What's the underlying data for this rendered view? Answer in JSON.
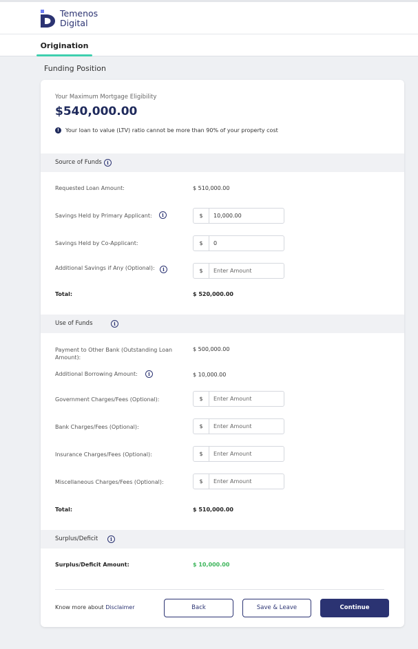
{
  "brand": {
    "line1": "Temenos",
    "line2": "Digital",
    "color": "#2b3372"
  },
  "tabs": [
    {
      "label": "Origination",
      "active": true
    }
  ],
  "page_title": "Funding Position",
  "eligibility": {
    "label": "Your Maximum Mortgage Eligibility",
    "amount": "$540,000.00",
    "note": "Your loan to value (LTV) ratio cannot be more than 90% of your property cost"
  },
  "source_of_funds": {
    "heading": "Source of Funds",
    "requested_label": "Requested Loan Amount:",
    "requested_value": "$ 510,000.00",
    "primary_label": "Savings Held by Primary Applicant:",
    "primary_prefix": "$",
    "primary_value": "10,000.00",
    "co_label": "Savings Held by Co-Applicant:",
    "co_prefix": "$",
    "co_value": "0",
    "additional_label": "Additional Savings if Any (Optional):",
    "additional_prefix": "$",
    "additional_placeholder": "Enter Amount",
    "total_label": "Total:",
    "total_value": "$ 520,000.00"
  },
  "use_of_funds": {
    "heading": "Use of Funds",
    "payment_label": "Payment to Other Bank (Outstanding Loan Amount):",
    "payment_value": "$ 500,000.00",
    "borrowing_label": "Additional Borrowing Amount:",
    "borrowing_value": "$ 10,000.00",
    "gov_label": "Government Charges/Fees (Optional):",
    "gov_prefix": "$",
    "gov_placeholder": "Enter Amount",
    "bank_label": "Bank Charges/Fees (Optional):",
    "bank_prefix": "$",
    "bank_placeholder": "Enter Amount",
    "insurance_label": "Insurance Charges/Fees (Optional):",
    "insurance_prefix": "$",
    "insurance_placeholder": "Enter Amount",
    "misc_label": "Miscellaneous Charges/Fees (Optional):",
    "misc_prefix": "$",
    "misc_placeholder": "Enter Amount",
    "total_label": "Total:",
    "total_value": "$ 510,000.00"
  },
  "surplus": {
    "heading": "Surplus/Deficit",
    "amount_label": "Surplus/Deficit Amount:",
    "amount_value": "$ 10,000.00",
    "value_color": "#3cb55a"
  },
  "footer": {
    "know_more": "Know more about",
    "disclaimer_link": "Disclaimer",
    "back_label": "Back",
    "save_label": "Save & Leave",
    "continue_label": "Continue"
  },
  "icons": {
    "info": "info-icon",
    "alert": "info-filled-icon"
  },
  "colors": {
    "accent": "#3ecfae",
    "primary": "#2b3372",
    "success": "#3cb55a"
  }
}
